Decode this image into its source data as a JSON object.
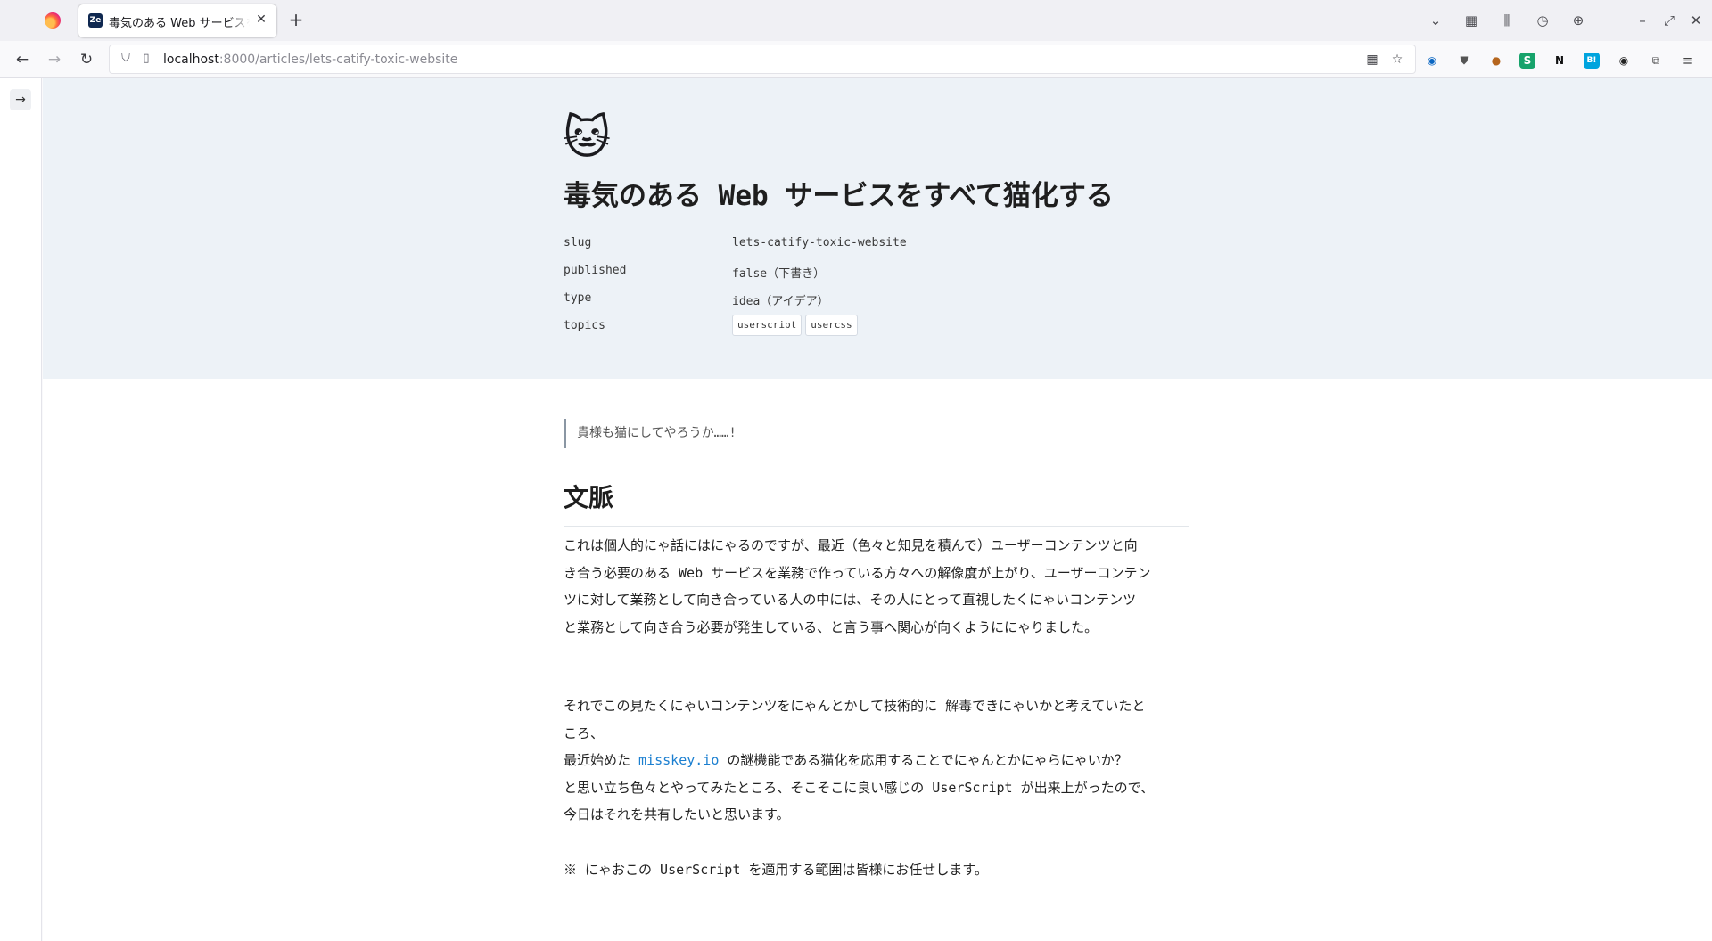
{
  "browser": {
    "tab_title": "毒気のある Web サービスをす",
    "tab_favicon_text": "Ze",
    "url_host": "localhost",
    "url_rest": ":8000/articles/lets-catify-toxic-website"
  },
  "article": {
    "emoji": "🐱",
    "title": "毒気のある Web サービスをすべて猫化する",
    "meta": {
      "slug_key": "slug",
      "slug_value": "lets-catify-toxic-website",
      "published_key": "published",
      "published_value": "false（下書き）",
      "type_key": "type",
      "type_value": "idea（アイデア）",
      "topics_key": "topics",
      "topics": [
        "userscript",
        "usercss"
      ]
    },
    "quote": "貴様も猫にしてやろうか……!",
    "heading": "文脈",
    "para1": [
      "これは個人的にゃ話にはにゃるのですが、最近（色々と知見を積んで）ユーザーコンテンツと向",
      "き合う必要のある Web サービスを業務で作っている方々への解像度が上がり、ユーザーコンテン",
      "ツに対して業務として向き合っている人の中には、その人にとって直視したくにゃいコンテンツ",
      "と業務として向き合う必要が発生している、と言う事へ関心が向くようににゃりました。"
    ],
    "para2": {
      "line1": "それでこの見たくにゃいコンテンツをにゃんとかして技術的に 解毒できにゃいかと考えていたと",
      "line2": "ころ、",
      "line3_before": "最近始めた ",
      "line3_link": "misskey.io",
      "line3_after": " の謎機能である猫化を応用することでにゃんとかにゃらにゃいか？",
      "line4": "と思い立ち色々とやってみたところ、そこそこに良い感じの UserScript が出来上がったので、",
      "line5": "今日はそれを共有したいと思います。"
    },
    "para3": "※ にゃおこの UserScript を適用する範囲は皆様にお任せします。"
  }
}
